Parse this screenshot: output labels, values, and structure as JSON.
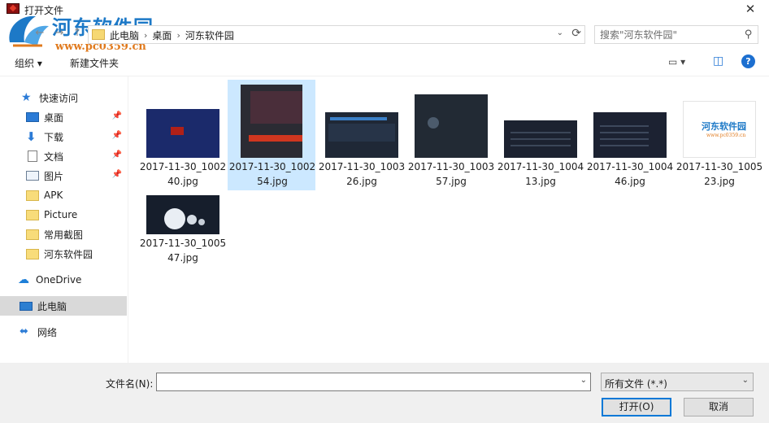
{
  "window": {
    "title": "打开文件",
    "close": "✕"
  },
  "watermark": {
    "title": "河东软件园",
    "url": "www.pc0359.cn"
  },
  "address": {
    "crumbs": [
      "此电脑",
      "桌面",
      "河东软件园"
    ],
    "separator": "›",
    "back": "←",
    "forward": "→",
    "up": "↑",
    "dropdown": "⌄",
    "refresh": "⟳"
  },
  "search": {
    "placeholder": "搜索\"河东软件园\"",
    "icon": "⚲"
  },
  "toolbar": {
    "organize": "组织 ▾",
    "new_folder": "新建文件夹",
    "view_icon": "▭ ▾",
    "pane_icon": "◫",
    "help": "?"
  },
  "sidebar": {
    "quick_access": "快速访问",
    "items": [
      {
        "label": "桌面",
        "pinned": true
      },
      {
        "label": "下载",
        "pinned": true
      },
      {
        "label": "文档",
        "pinned": true
      },
      {
        "label": "图片",
        "pinned": true
      },
      {
        "label": "APK",
        "pinned": false
      },
      {
        "label": "Picture",
        "pinned": false
      },
      {
        "label": "常用截图",
        "pinned": false
      },
      {
        "label": "河东软件园",
        "pinned": false
      }
    ],
    "onedrive": "OneDrive",
    "this_pc": "此电脑",
    "network": "网络",
    "pin_glyph": "📌"
  },
  "files": [
    {
      "name": "2017-11-30_100240.jpg"
    },
    {
      "name": "2017-11-30_100254.jpg",
      "selected": true
    },
    {
      "name": "2017-11-30_100326.jpg"
    },
    {
      "name": "2017-11-30_100357.jpg"
    },
    {
      "name": "2017-11-30_100413.jpg"
    },
    {
      "name": "2017-11-30_100446.jpg"
    },
    {
      "name": "2017-11-30_100523.jpg"
    },
    {
      "name": "2017-11-30_100547.jpg"
    }
  ],
  "thumb7": {
    "title": "河东软件园",
    "url": "www.pc0359.cn"
  },
  "footer": {
    "filename_label": "文件名(N):",
    "filename_value": "",
    "filetype": "所有文件 (*.*)",
    "dropdown": "⌄",
    "open": "打开(O)",
    "cancel": "取消"
  }
}
